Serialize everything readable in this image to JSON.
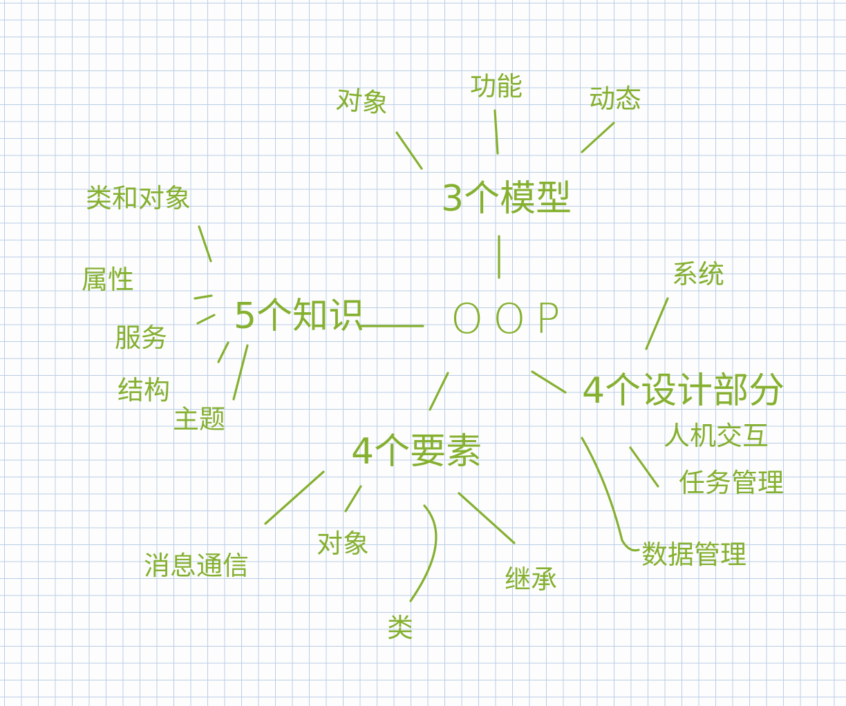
{
  "diagram": {
    "center": "OOP",
    "branches": [
      {
        "key": "models",
        "label": "3个模型",
        "children": [
          "对象",
          "功能",
          "动态"
        ]
      },
      {
        "key": "knowledge",
        "label": "5个知识",
        "children": [
          "类和对象",
          "属性",
          "服务",
          "结构",
          "主题"
        ]
      },
      {
        "key": "design",
        "label": "4个设计部分",
        "children": [
          "系统",
          "人机交互",
          "任务管理",
          "数据管理"
        ]
      },
      {
        "key": "elements",
        "label": "4个要素",
        "children": [
          "消息通信",
          "对象",
          "类",
          "继承"
        ]
      }
    ]
  },
  "colors": {
    "ink": "#85b030",
    "grid": "#b9cde6",
    "paper": "#fdfdfd"
  }
}
